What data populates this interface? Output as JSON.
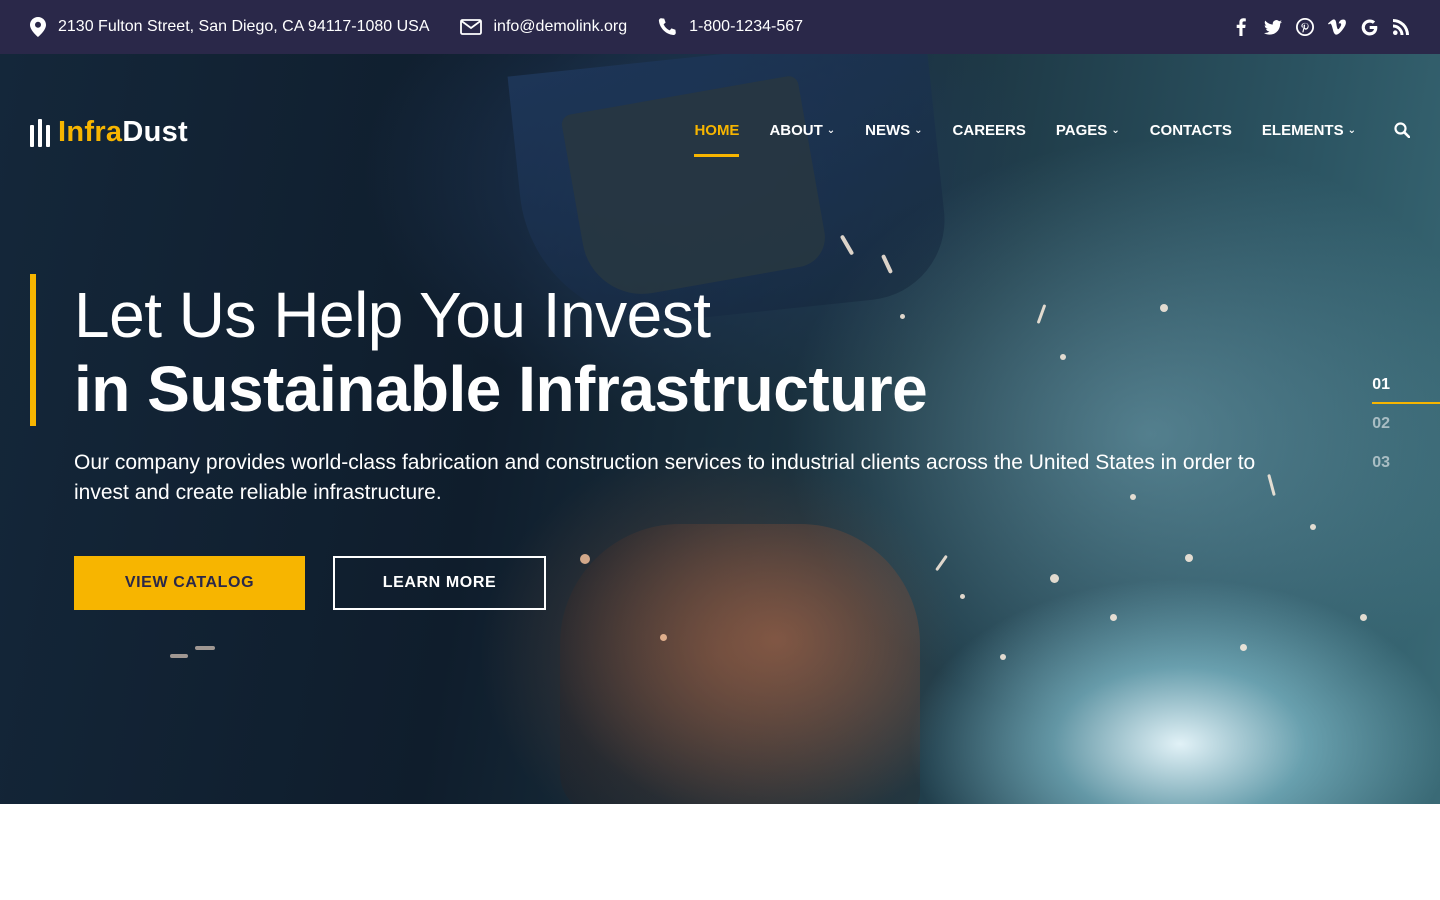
{
  "topbar": {
    "address": "2130 Fulton Street, San Diego, CA 94117-1080 USA",
    "email": "info@demolink.org",
    "phone": "1-800-1234-567",
    "social_icons": [
      "facebook-icon",
      "twitter-icon",
      "pinterest-icon",
      "vimeo-icon",
      "google-icon",
      "rss-icon"
    ]
  },
  "logo": {
    "part1": "Infra",
    "part2": "Dust"
  },
  "nav": {
    "items": [
      {
        "label": "HOME",
        "active": true,
        "dropdown": false
      },
      {
        "label": "ABOUT",
        "dropdown": true
      },
      {
        "label": "NEWS",
        "dropdown": true
      },
      {
        "label": "CAREERS",
        "dropdown": false
      },
      {
        "label": "PAGES",
        "dropdown": true
      },
      {
        "label": "CONTACTS",
        "dropdown": false
      },
      {
        "label": "ELEMENTS",
        "dropdown": true
      }
    ]
  },
  "hero": {
    "heading_line1": "Let Us Help You Invest",
    "heading_line2": "in Sustainable Infrastructure",
    "description": "Our company provides world-class fabrication and construction services to industrial clients across the United States in order to invest and create reliable infrastructure.",
    "primary_button": "VIEW CATALOG",
    "secondary_button": "LEARN MORE"
  },
  "pager": {
    "items": [
      "01",
      "02",
      "03"
    ],
    "active": "01"
  },
  "colors": {
    "accent": "#f7b500",
    "topbar": "#2a2849"
  }
}
